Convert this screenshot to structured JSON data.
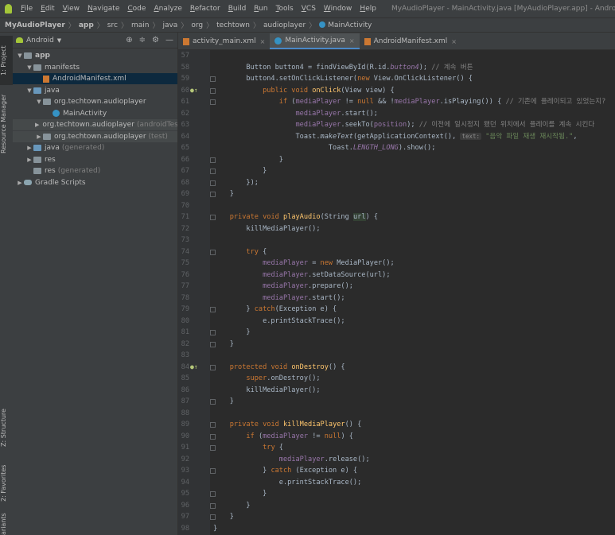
{
  "menubar": {
    "items": [
      "File",
      "Edit",
      "View",
      "Navigate",
      "Code",
      "Analyze",
      "Refactor",
      "Build",
      "Run",
      "Tools",
      "VCS",
      "Window",
      "Help"
    ],
    "window_title": "MyAudioPlayer - MainActivity.java [MyAudioPlayer.app] - Android Studio - Administ"
  },
  "breadcrumb": [
    "MyAudioPlayer",
    "app",
    "src",
    "main",
    "java",
    "org",
    "techtown",
    "audioplayer",
    "MainActivity"
  ],
  "left_tabs": {
    "project": "1: Project",
    "resource_manager": "Resource Manager",
    "structure": "Z: Structure",
    "favorites": "2: Favorites",
    "variants": "ariants"
  },
  "project_panel": {
    "view_mode": "Android",
    "tree": [
      {
        "label": "app",
        "depth": 0,
        "expanded": true,
        "icon": "folder",
        "bold": true
      },
      {
        "label": "manifests",
        "depth": 1,
        "expanded": true,
        "icon": "folder"
      },
      {
        "label": "AndroidManifest.xml",
        "depth": 2,
        "icon": "xml",
        "selected": true
      },
      {
        "label": "java",
        "depth": 1,
        "expanded": true,
        "icon": "folder-blue"
      },
      {
        "label": "org.techtown.audioplayer",
        "depth": 2,
        "expanded": true,
        "icon": "folder"
      },
      {
        "label": "MainActivity",
        "depth": 3,
        "icon": "class"
      },
      {
        "label": "org.techtown.audioplayer",
        "suffix": "(androidTest)",
        "depth": 2,
        "expanded": false,
        "icon": "folder",
        "dim": true
      },
      {
        "label": "org.techtown.audioplayer",
        "suffix": "(test)",
        "depth": 2,
        "expanded": false,
        "icon": "folder",
        "dim": true
      },
      {
        "label": "java",
        "suffix": "(generated)",
        "depth": 1,
        "expanded": false,
        "icon": "folder-blue"
      },
      {
        "label": "res",
        "depth": 1,
        "expanded": false,
        "icon": "folder"
      },
      {
        "label": "res",
        "suffix": "(generated)",
        "depth": 1,
        "icon": "folder"
      },
      {
        "label": "Gradle Scripts",
        "depth": 0,
        "expanded": false,
        "icon": "gradle"
      }
    ]
  },
  "editor_tabs": [
    {
      "label": "activity_main.xml",
      "active": false
    },
    {
      "label": "MainActivity.java",
      "active": true
    },
    {
      "label": "AndroidManifest.xml",
      "active": false
    }
  ],
  "code_lines": [
    {
      "n": "57",
      "html": ""
    },
    {
      "n": "58",
      "html": "        Button button4 = findViewById(R.id.<span class=\"p i\">button4</span>); <span class=\"c\">// 계속 버튼</span>"
    },
    {
      "n": "59",
      "html": "        button4.setOnClickListener(<span class=\"k\">new</span> View.OnClickListener() {",
      "fold": true
    },
    {
      "n": "60",
      "html": "            <span class=\"k\">public void</span> <span class=\"f\">onClick</span>(View view) {",
      "override": true,
      "fold": true
    },
    {
      "n": "61",
      "html": "                <span class=\"k\">if</span> (<span class=\"p\">mediaPlayer</span> != <span class=\"k\">null</span> &amp;&amp; !<span class=\"p\">mediaPlayer</span>.isPlaying()) { <span class=\"c\">// 기존에 플레이되고 있었는지?</span>",
      "fold": true
    },
    {
      "n": "62",
      "html": "                    <span class=\"p\">mediaPlayer</span>.start();"
    },
    {
      "n": "63",
      "html": "                    <span class=\"p\">mediaPlayer</span>.seekTo(<span class=\"p\">position</span>); <span class=\"c\">// 이전에 일시정지 됐던 위치에서 플레이를 계속 시킨다</span>"
    },
    {
      "n": "64",
      "html": "                    Toast.<span class=\"i\">makeText</span>(getApplicationContext(), <span class=\"hint\">text:</span> <span class=\"s\">\"음악 파일 재생 재시작됨.\"</span>,"
    },
    {
      "n": "65",
      "html": "                            Toast.<span class=\"p i\">LENGTH_LONG</span>).show();"
    },
    {
      "n": "66",
      "html": "                }",
      "fold": true
    },
    {
      "n": "67",
      "html": "            }",
      "fold": true
    },
    {
      "n": "68",
      "html": "        });",
      "fold": true
    },
    {
      "n": "69",
      "html": "    }",
      "fold": true
    },
    {
      "n": "70",
      "html": ""
    },
    {
      "n": "71",
      "html": "    <span class=\"k\">private void</span> <span class=\"f\">playAudio</span>(String <span class=\"param-hl\">url</span>) {",
      "fold": true
    },
    {
      "n": "72",
      "html": "        killMediaPlayer();"
    },
    {
      "n": "73",
      "html": ""
    },
    {
      "n": "74",
      "html": "        <span class=\"k\">try</span> {",
      "fold": true
    },
    {
      "n": "75",
      "html": "            <span class=\"p\">mediaPlayer</span> = <span class=\"k\">new</span> MediaPlayer();"
    },
    {
      "n": "76",
      "html": "            <span class=\"p\">mediaPlayer</span>.setDataSource(url);"
    },
    {
      "n": "77",
      "html": "            <span class=\"p\">mediaPlayer</span>.prepare();"
    },
    {
      "n": "78",
      "html": "            <span class=\"p\">mediaPlayer</span>.start();"
    },
    {
      "n": "79",
      "html": "        } <span class=\"k\">catch</span>(Exception e) {",
      "fold": true
    },
    {
      "n": "80",
      "html": "            e.printStackTrace();"
    },
    {
      "n": "81",
      "html": "        }",
      "fold": true
    },
    {
      "n": "82",
      "html": "    }",
      "fold": true
    },
    {
      "n": "83",
      "html": ""
    },
    {
      "n": "84",
      "html": "    <span class=\"k\">protected void</span> <span class=\"f\">onDestroy</span>() {",
      "override": true,
      "fold": true
    },
    {
      "n": "85",
      "html": "        <span class=\"k\">super</span>.onDestroy();"
    },
    {
      "n": "86",
      "html": "        killMediaPlayer();"
    },
    {
      "n": "87",
      "html": "    }",
      "fold": true
    },
    {
      "n": "88",
      "html": ""
    },
    {
      "n": "89",
      "html": "    <span class=\"k\">private void</span> <span class=\"f\">killMediaPlayer</span>() {",
      "fold": true
    },
    {
      "n": "90",
      "html": "        <span class=\"k\">if</span> (<span class=\"p\">mediaPlayer</span> != <span class=\"k\">null</span>) {",
      "fold": true
    },
    {
      "n": "91",
      "html": "            <span class=\"k\">try</span> {",
      "fold": true
    },
    {
      "n": "92",
      "html": "                <span class=\"p\">mediaPlayer</span>.release();"
    },
    {
      "n": "93",
      "html": "            } <span class=\"k\">catch</span> (Exception e) {",
      "fold": true
    },
    {
      "n": "94",
      "html": "                e.printStackTrace();"
    },
    {
      "n": "95",
      "html": "            }",
      "fold": true
    },
    {
      "n": "96",
      "html": "        }",
      "fold": true
    },
    {
      "n": "97",
      "html": "    }",
      "fold": true
    },
    {
      "n": "98",
      "html": "}"
    }
  ],
  "colors": {
    "keyword": "#cc7832",
    "function": "#ffc66d",
    "field": "#9876aa",
    "comment": "#808080",
    "string": "#6a8759",
    "text": "#a9b7c6",
    "accent": "#4a88c7"
  },
  "icons": {
    "app": "android-icon",
    "settings": "gear-icon",
    "collapse": "collapse-icon",
    "target": "target-icon",
    "hide": "minimize-icon"
  }
}
